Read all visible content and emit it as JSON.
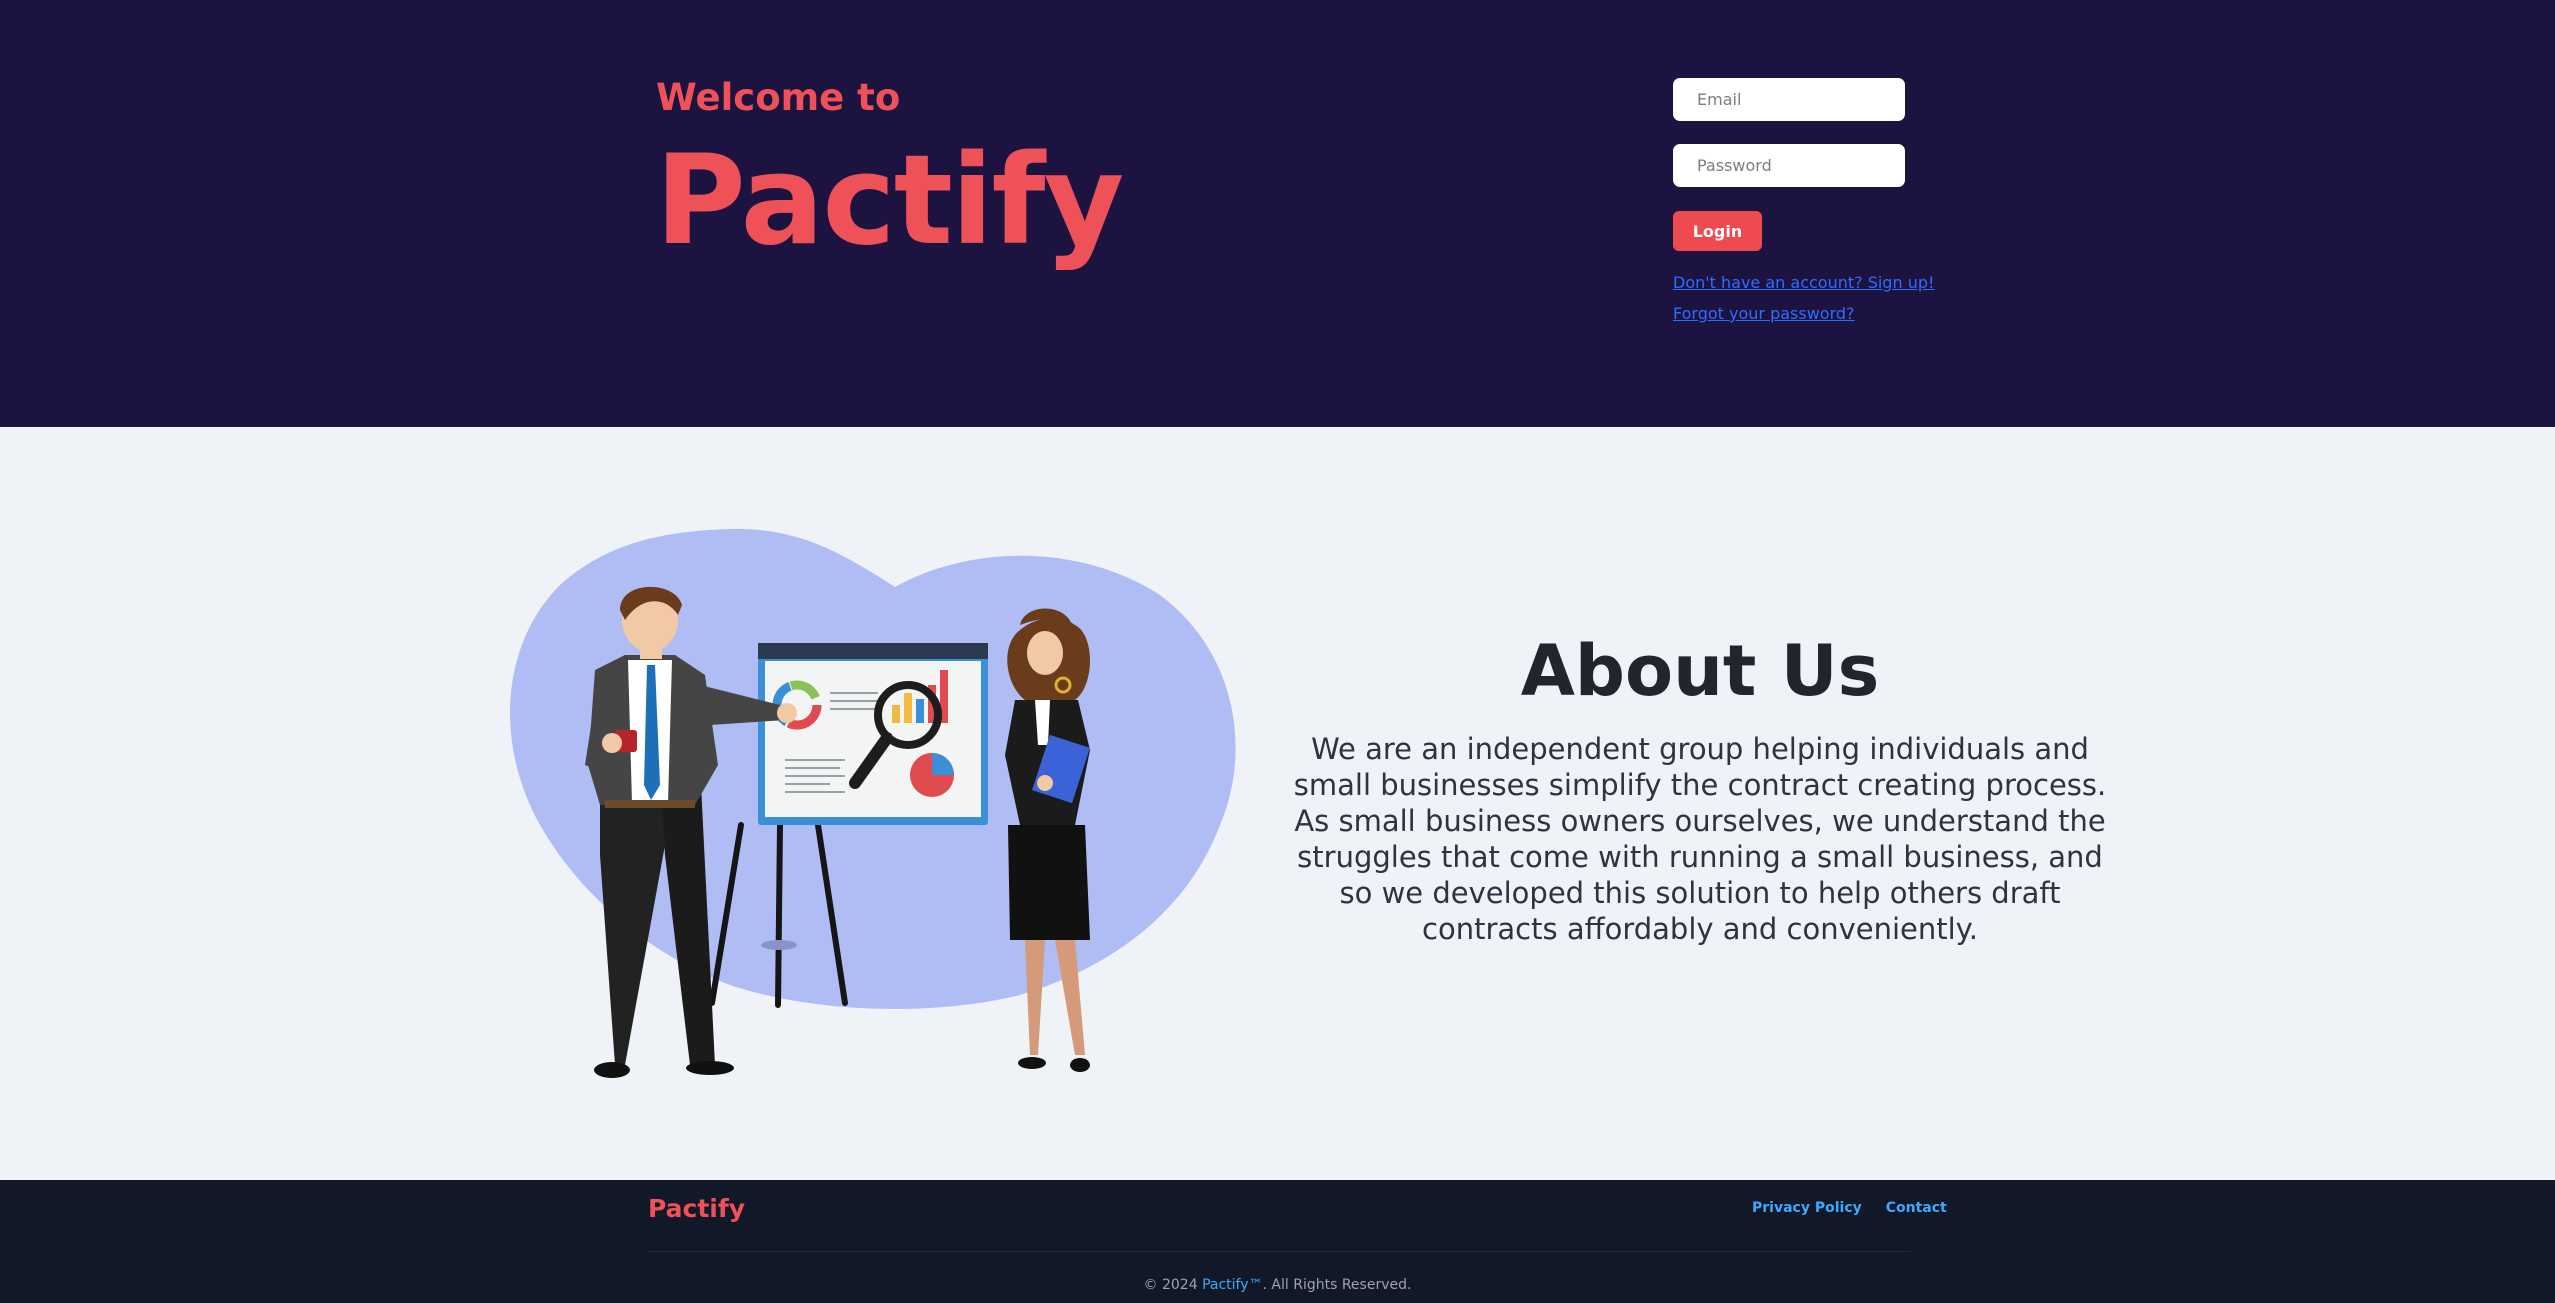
{
  "hero": {
    "welcome": "Welcome to",
    "brand": "Pactify"
  },
  "login": {
    "email_placeholder": "Email",
    "password_placeholder": "Password",
    "login_label": "Login",
    "signup_link": "Don't have an account? Sign up!",
    "forgot_link": "Forgot your password?"
  },
  "about": {
    "title": "About Us",
    "body": "We are an independent group helping individuals and small businesses simplify the contract creating process. As small business owners ourselves, we understand the struggles that come with running a small business, and so we developed this solution to help others draft contracts affordably and conveniently."
  },
  "footer": {
    "brand": "Pactify",
    "links": [
      "Privacy Policy",
      "Contact"
    ],
    "copyright_prefix": "© 2024 ",
    "copyright_brand": "Pactify™",
    "copyright_suffix": ". All Rights Reserved."
  },
  "colors": {
    "hero_bg": "#1c1340",
    "accent": "#ef5158",
    "link": "#2f6cff",
    "footer_bg": "#111827",
    "footer_link": "#3da8ff",
    "page_bg": "#eff2f7"
  }
}
